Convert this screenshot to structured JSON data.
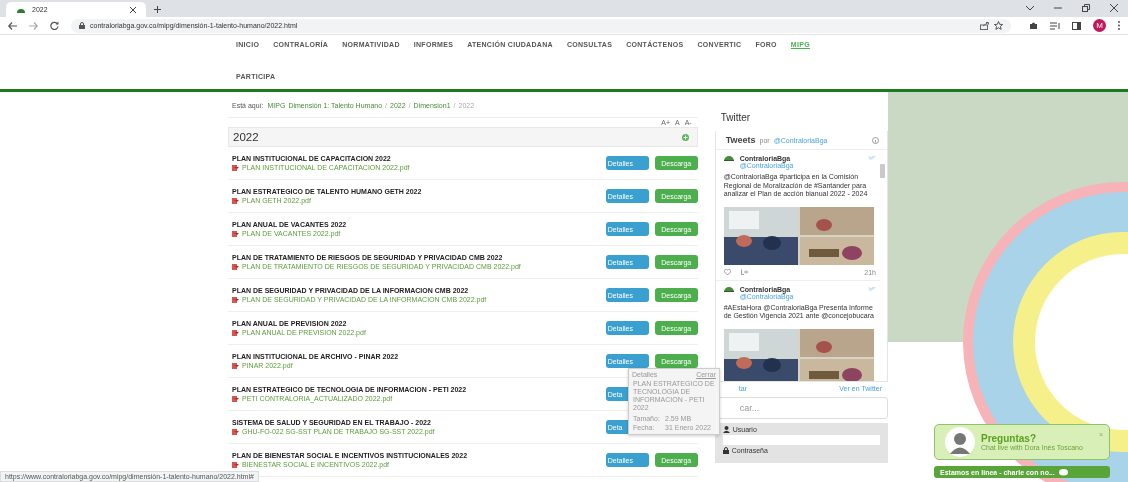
{
  "browser": {
    "tab_title": "2022",
    "url": "contraloriabga.gov.co/mipg/dimensión-1-talento-humano/2022.html",
    "avatar": "M"
  },
  "nav": [
    {
      "label": "INICIO",
      "selected": false
    },
    {
      "label": "CONTRALORÍA",
      "selected": false
    },
    {
      "label": "NORMATIVIDAD",
      "selected": false
    },
    {
      "label": "INFORMES",
      "selected": false
    },
    {
      "label": "ATENCIÓN CIUDADANA",
      "selected": false
    },
    {
      "label": "CONSULTAS",
      "selected": false
    },
    {
      "label": "CONTÁCTENOS",
      "selected": false
    },
    {
      "label": "CONVERTIC",
      "selected": false
    },
    {
      "label": "FORO",
      "selected": false
    },
    {
      "label": "MIPG",
      "selected": true
    },
    {
      "label": "PARTICIPA",
      "selected": false
    }
  ],
  "breadcrumb": {
    "prefix": "Está aquí:",
    "items": [
      {
        "text": "MIPG",
        "kind": "link"
      },
      {
        "text": "Dimensión 1: Talento Humano",
        "kind": "link"
      },
      {
        "text": "/",
        "kind": "separator"
      },
      {
        "text": "2022",
        "kind": "link"
      },
      {
        "text": "/",
        "kind": "separator"
      },
      {
        "text": "Dimension1",
        "kind": "link"
      },
      {
        "text": "/",
        "kind": "separator"
      },
      {
        "text": "2022",
        "kind": "current"
      }
    ]
  },
  "font_controls": [
    "A+",
    "A",
    "A-"
  ],
  "panel": {
    "title": "2022",
    "rows": [
      {
        "title": "PLAN INSTITUCIONAL DE CAPACITACION 2022",
        "file": "PLAN INSTITUCIONAL DE CAPACITACION 2022.pdf",
        "buttons": [
          {
            "label": "Detalles",
            "kind": "details"
          },
          {
            "label": "Descarga",
            "kind": "download"
          }
        ]
      },
      {
        "title": "PLAN ESTRATEGICO DE TALENTO HUMANO GETH 2022",
        "file": "PLAN GETH 2022.pdf",
        "buttons": [
          {
            "label": "Detalles",
            "kind": "details"
          },
          {
            "label": "Descarga",
            "kind": "download"
          }
        ]
      },
      {
        "title": "PLAN ANUAL DE VACANTES 2022",
        "file": "PLAN DE VACANTES 2022.pdf",
        "buttons": [
          {
            "label": "Detalles",
            "kind": "details"
          },
          {
            "label": "Descarga",
            "kind": "download"
          }
        ]
      },
      {
        "title": "PLAN DE TRATAMIENTO DE RIESGOS DE SEGURIDAD Y PRIVACIDAD CMB 2022",
        "file": "PLAN DE TRATAMIENTO DE RIESGOS DE SEGURIDAD Y PRIVACIDAD CMB 2022.pdf",
        "buttons": [
          {
            "label": "Detalles",
            "kind": "details"
          },
          {
            "label": "Descarga",
            "kind": "download"
          }
        ]
      },
      {
        "title": "PLAN DE SEGURIDAD Y PRIVACIDAD DE LA INFORMACION CMB 2022",
        "file": "PLAN DE SEGURIDAD Y PRIVACIDAD DE LA INFORMACION CMB 2022.pdf",
        "buttons": [
          {
            "label": "Detalles",
            "kind": "details"
          },
          {
            "label": "Descarga",
            "kind": "download"
          }
        ]
      },
      {
        "title": "PLAN ANUAL DE PREVISION 2022",
        "file": "PLAN ANUAL DE PREVISION 2022.pdf",
        "buttons": [
          {
            "label": "Detalles",
            "kind": "details"
          },
          {
            "label": "Descarga",
            "kind": "download"
          }
        ]
      },
      {
        "title": "PLAN INSTITUCIONAL DE ARCHIVO - PINAR 2022",
        "file": "PINAR 2022.pdf",
        "buttons": [
          {
            "label": "Detalles",
            "kind": "details"
          },
          {
            "label": "Descarga",
            "kind": "download"
          }
        ]
      },
      {
        "title": "PLAN ESTRATEGICO DE TECNOLOGIA DE INFORMACION - PETI 2022",
        "file": "PETI CONTRALORIA_ACTUALIZADO 2022.pdf",
        "buttons": [
          {
            "label": "Deta",
            "kind": "details"
          }
        ]
      },
      {
        "title": "SISTEMA DE SALUD Y SEGURIDAD EN EL TRABAJO - 2022",
        "file": "GHU-FO-022 SG-SST PLAN DE TRABAJO SG-SST 2022.pdf",
        "buttons": [
          {
            "label": "Deta",
            "kind": "details"
          }
        ]
      },
      {
        "title": "PLAN DE BIENESTAR SOCIAL E INCENTIVOS INSTITUCIONALES 2022",
        "file": "BIENESTAR SOCIAL E INCENTIVOS 2022.pdf",
        "buttons": [
          {
            "label": "Detalles",
            "kind": "details"
          },
          {
            "label": "Descarga",
            "kind": "download"
          }
        ]
      }
    ]
  },
  "tooltip": {
    "heading": "Detalles",
    "close": "Cerrar",
    "title": "PLAN ESTRATEGICO DE TECNOLOGIA DE INFORMACION - PETI 2022",
    "fields": [
      {
        "label": "Tamaño:",
        "value": "2.59 MB"
      },
      {
        "label": "Fecha:",
        "value": "31 Enero 2022"
      }
    ]
  },
  "sidebar": {
    "title": "Twitter",
    "widget_title": "Tweets",
    "widget_by": "por",
    "widget_handle": "@ContraloriaBga",
    "tweets": [
      {
        "name": "ContraloriaBga",
        "handle": "@ContraloriaBga",
        "text": "@ContraloriaBga #participa en la Comisión Regional de Moralización de #Santander para analizar el Plan de acción bianual 2022 - 2024",
        "time": "21h",
        "kind": "picture"
      },
      {
        "name": "ContraloriaBga",
        "handle": "@ContraloriaBga",
        "text": "#AEstaHora @ContraloriaBga Presenta Informe de Gestión Vigencia 2021 ante @concejobucara",
        "kind": "picture"
      }
    ],
    "embed": "tar",
    "view_link": "Ver en Twitter",
    "search_placeholder": "car...",
    "login": {
      "user_label": "Usuario",
      "password_label": "Contraseña"
    }
  },
  "chat": {
    "title": "Preguntas?",
    "subtitle": "Chat live with Dora Inés Toscano",
    "close": "×",
    "bar": "Estamos en linea - charle con no..."
  },
  "status_url": "https://www.contraloriabga.gov.co/mipg/dimensión-1-talento-humano/2022.html#"
}
